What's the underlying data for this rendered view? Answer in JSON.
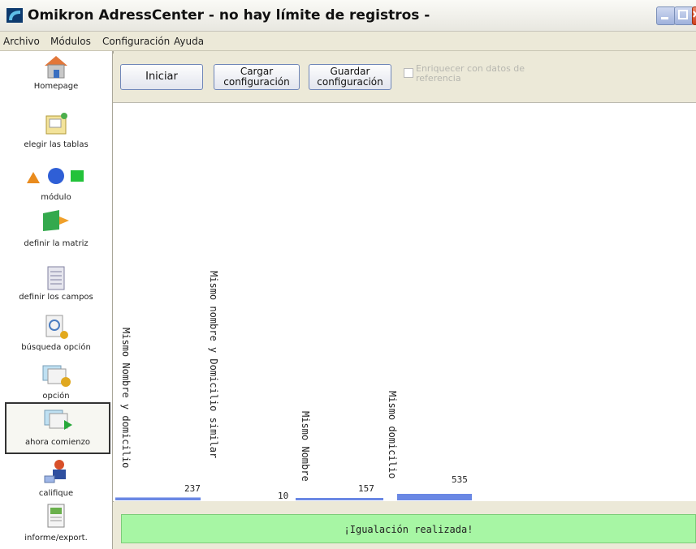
{
  "window": {
    "title": "Omikron AdressCenter - no hay límite de registros -"
  },
  "menu": [
    "Archivo",
    "Módulos",
    "Configuración",
    "Ayuda"
  ],
  "sidebar": {
    "items": [
      {
        "label": "Homepage",
        "icon": "house-icon"
      },
      {
        "label": "elegir las tablas",
        "icon": "table-folder-icon"
      },
      {
        "label": "módulo",
        "icon": "shapes-icon"
      },
      {
        "label": "definir la matriz",
        "icon": "matrix-arrow-icon"
      },
      {
        "label": "definir los campos",
        "icon": "fields-list-icon"
      },
      {
        "label": "búsqueda opción",
        "icon": "search-gear-icon"
      },
      {
        "label": "opción",
        "icon": "cards-gear-icon"
      },
      {
        "label": "ahora comienzo",
        "icon": "cards-arrow-icon"
      },
      {
        "label": "califique",
        "icon": "person-rating-icon"
      },
      {
        "label": "informe/export.",
        "icon": "report-export-icon"
      }
    ],
    "selected": "ahora comienzo"
  },
  "toolbar": {
    "iniciar": "Iniciar",
    "cargar_1": "Cargar",
    "cargar_2": "configuración",
    "guardar_1": "Guardar",
    "guardar_2": "configuración",
    "enrich_1": "Enriquecer con datos de",
    "enrich_2": "referencia",
    "enrich_checked": false
  },
  "chart_data": {
    "type": "bar",
    "categories": [
      "Mismo Nombre y domicilio",
      "Mismo nombre y Domicilio similar",
      "Mismo Nombre",
      "Mismo domicilio"
    ],
    "values": [
      237,
      10,
      157,
      535
    ],
    "value_labels": [
      "237",
      "10",
      "157",
      "535"
    ],
    "bar_color": "#6a88e4"
  },
  "status": {
    "message": "¡Igualación realizada!"
  }
}
